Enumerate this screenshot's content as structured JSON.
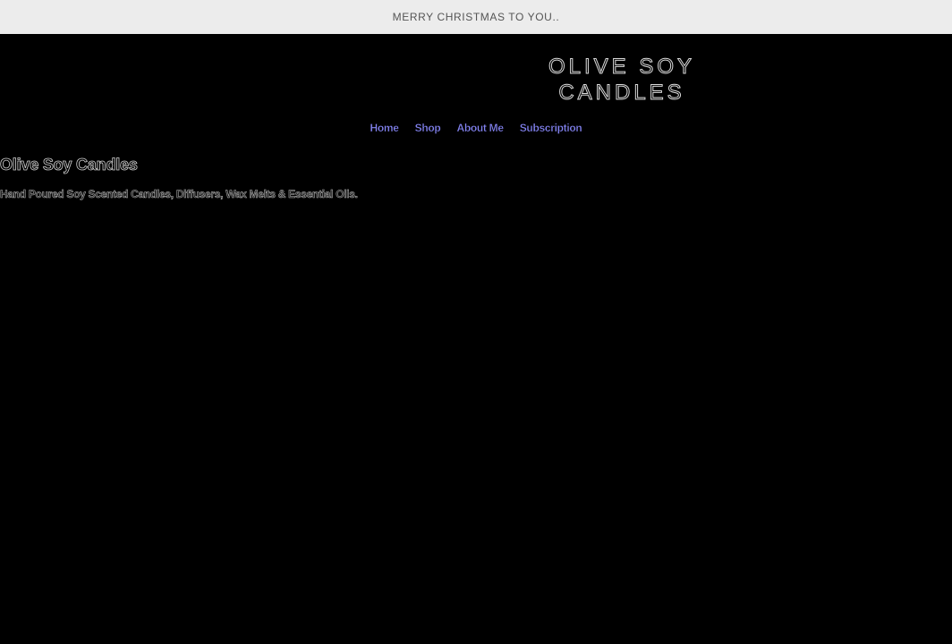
{
  "announcement": {
    "text": "MERRY CHRISTMAS TO YOU.."
  },
  "header": {
    "logo_line1": "OLIVE SOY",
    "logo_line2": "CANDLES"
  },
  "nav": {
    "items": [
      {
        "label": "Home"
      },
      {
        "label": "Shop"
      },
      {
        "label": "About Me"
      },
      {
        "label": "Subscription"
      }
    ]
  },
  "main": {
    "heading": "Olive Soy Candles",
    "tagline": "Hand Poured Soy Scented Candles, Diffusers, Wax Melts & Essential Oils."
  },
  "colors": {
    "page_background": "#000000",
    "announcement_background": "#ececec",
    "nav_link": "#8585f5"
  }
}
